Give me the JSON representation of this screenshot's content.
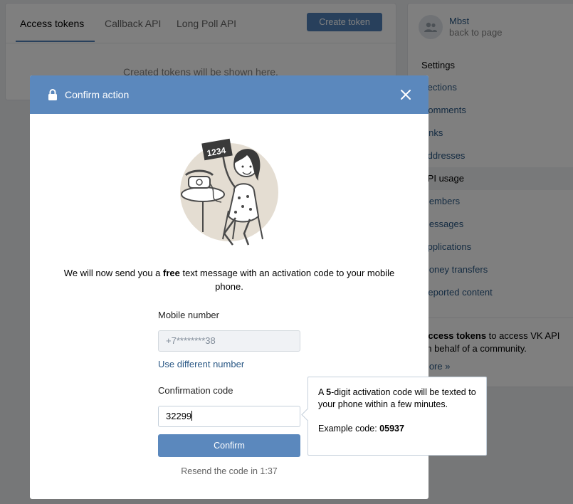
{
  "tabs": [
    {
      "label": "Access tokens",
      "active": true
    },
    {
      "label": "Callback API",
      "active": false
    },
    {
      "label": "Long Poll API",
      "active": false
    }
  ],
  "create_token_label": "Create token",
  "empty_text": "Created tokens will be shown here.",
  "sidebar": {
    "community_name": "Mbst",
    "back_label": "back to page",
    "settings_label": "Settings",
    "items": [
      {
        "label": "Sections"
      },
      {
        "label": "Comments"
      },
      {
        "label": "Links"
      },
      {
        "label": "Addresses"
      },
      {
        "label": "API usage",
        "active": true
      },
      {
        "label": "Members"
      },
      {
        "label": "Messages"
      },
      {
        "label": "Applications"
      },
      {
        "label": "Money transfers"
      },
      {
        "label": "Reported content"
      }
    ],
    "note_bold": "Access tokens",
    "note_rest": " to access VK API on behalf of a community.",
    "more_label": "More »"
  },
  "modal": {
    "title": "Confirm action",
    "illustration_code": "1234",
    "intro_before": "We will now send you a ",
    "intro_bold": "free",
    "intro_after": " text message with an activation code to your mobile phone.",
    "mobile_label": "Mobile number",
    "mobile_value": "+7********38",
    "different_number_label": "Use different number",
    "code_label": "Confirmation code",
    "code_value": "32299",
    "confirm_label": "Confirm",
    "resend_text": "Resend the code in 1:37"
  },
  "tooltip": {
    "line_prefix": "A ",
    "digits": "5",
    "line_rest": "-digit activation code will be texted to your phone within a few minutes.",
    "example_label": "Example code: ",
    "example_code": "05937"
  },
  "colors": {
    "accent": "#5b88bd",
    "link": "#2a5885",
    "overlay": "rgba(0,0,0,0.5)"
  }
}
